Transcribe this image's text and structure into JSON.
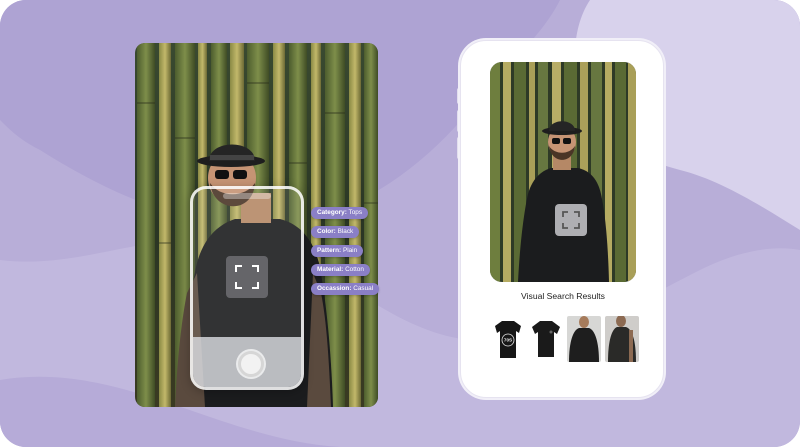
{
  "overlay_tags": [
    {
      "key": "Category:",
      "value": "Tops"
    },
    {
      "key": "Color:",
      "value": "Black"
    },
    {
      "key": "Pattern:",
      "value": "Plain"
    },
    {
      "key": "Material:",
      "value": "Cotton"
    },
    {
      "key": "Occassion:",
      "value": "Casual"
    }
  ],
  "results": {
    "title": "Visual Search Results",
    "thumbnail_print": "70S"
  },
  "icons": [
    "camera-focus-icon",
    "shutter-button-icon"
  ],
  "colors": {
    "background": "#b8aed8",
    "background_light": "#d8d2ec",
    "tag_fill": "#8a7fc6",
    "phone_frame": "#ffffff"
  }
}
